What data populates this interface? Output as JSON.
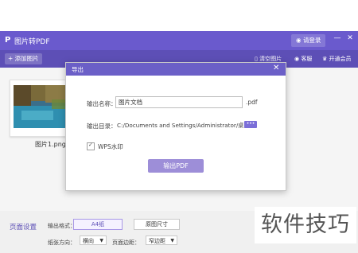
{
  "app": {
    "logo_glyph": "P",
    "title": "图片转PDF",
    "login": "请登录",
    "minimize": "—",
    "close": "✕"
  },
  "toolbar": {
    "add": "添加图片",
    "clear": "清空图片",
    "service": "客服",
    "vip": "开通会员"
  },
  "image": {
    "name": "图片1.png"
  },
  "dialog": {
    "title": "导出",
    "close": "✕",
    "name_label": "输出名称：",
    "name_value": "图片文档",
    "ext": ".pdf",
    "dir_label": "输出目录：",
    "dir_value": "C:/Documents and Settings/Administrator/桌面",
    "browse": "•••",
    "watermark_label": "WPS水印",
    "watermark_checked": true,
    "export": "输出PDF"
  },
  "page_settings": {
    "title": "页面设置",
    "format_label": "输出格式：",
    "format_value": "A4纸",
    "original_size": "原图尺寸",
    "direction_label": "纸张方向：",
    "direction_value": "横向",
    "margin_label": "页面边距：",
    "margin_value": "窄边距"
  },
  "overlay_watermark": "软件技巧",
  "colors": {
    "title_bar": "#6a5acd",
    "toolbar": "#5d4fb6",
    "dialog_header": "#6b5fc7",
    "export_button": "#9d8ed8"
  }
}
